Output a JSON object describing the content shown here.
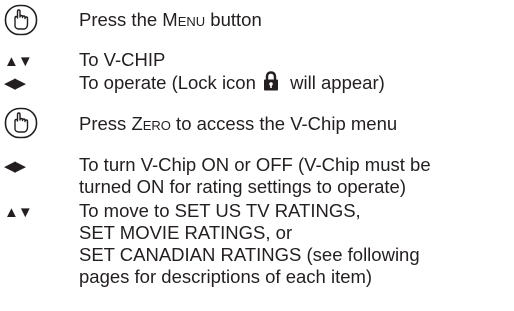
{
  "steps": [
    {
      "icon": "pointing-hand-icon",
      "text_before": "Press the ",
      "text_smallcaps": "Menu",
      "text_after": " button"
    },
    {
      "glyph": "▲▼",
      "line1": "To V-CHIP"
    },
    {
      "glyph": "◀▶",
      "line1_before": "To operate (Lock icon",
      "lock_icon": "lock-icon",
      "line1_after": " will appear)"
    },
    {
      "icon": "pointing-hand-icon",
      "text_before": "Press ",
      "text_smallcaps": "Zero",
      "text_after": " to access the V-Chip menu"
    },
    {
      "glyph": "◀▶",
      "line1": "To turn V-Chip ON or OFF (V-Chip must be",
      "line2": "turned ON for rating settings to operate)"
    },
    {
      "glyph": "▲▼",
      "line1": "To move to SET US TV RATINGS,",
      "line2": "SET MOVIE RATINGS, or",
      "line3": "SET CANADIAN RATINGS (see following",
      "line4": "pages for descriptions of each item)"
    }
  ]
}
